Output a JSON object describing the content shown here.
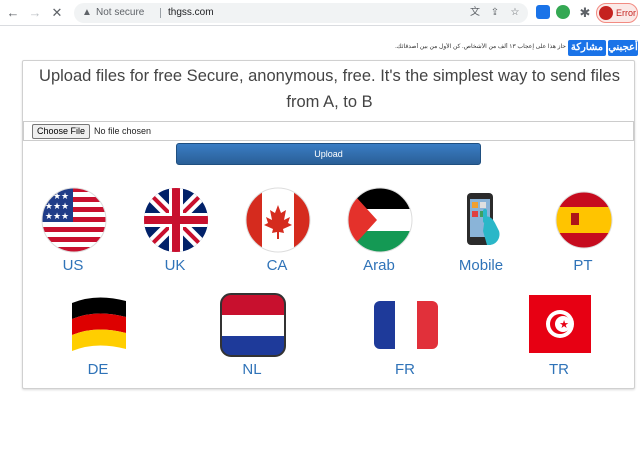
{
  "browser": {
    "address": {
      "security": "Not secure",
      "url": "thgss.com"
    },
    "profile": {
      "label": "Error"
    },
    "icons": [
      "back-icon",
      "forward-icon",
      "stop-icon",
      "warning-icon",
      "translate-icon",
      "share-icon",
      "star-icon",
      "extensions-icon"
    ]
  },
  "header": {
    "like_label": "أعجبني",
    "share_label": "مشاركة",
    "note": "حاز هذا على إعجاب ١٣ ألف من الأشخاص. كن الأول من بين أصدقائك."
  },
  "main": {
    "headline": "Upload files for free Secure, anonymous, free. It's the simplest way to send files from A, to B",
    "file_input": {
      "button_label": "Choose File",
      "status": "No file chosen"
    },
    "upload_label": "Upload"
  },
  "flags": [
    {
      "label": "US"
    },
    {
      "label": "UK"
    },
    {
      "label": "CA"
    },
    {
      "label": "Arab"
    },
    {
      "label": "Mobile"
    },
    {
      "label": "PT"
    },
    {
      "label": "DE"
    },
    {
      "label": "NL"
    },
    {
      "label": "FR"
    },
    {
      "label": "TR"
    }
  ],
  "colors": {
    "accent": "#1a73e8",
    "link": "#2f73b8",
    "upload": "#2a5f97"
  }
}
